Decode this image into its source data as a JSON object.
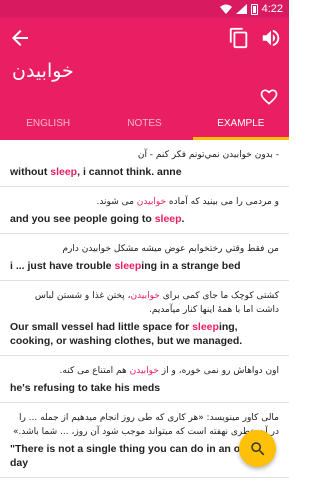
{
  "status_bar": {
    "time": "4:22",
    "battery_label": "2"
  },
  "header": {
    "word": "خوابیدن"
  },
  "tabs": [
    {
      "label": "ENGLISH",
      "active": false
    },
    {
      "label": "NOTES",
      "active": false
    },
    {
      "label": "EXAMPLE",
      "active": true
    }
  ],
  "examples": [
    {
      "fa_parts": [
        {
          "text": "- بدون خوابیدن نمي‌تونم فكر كنم - آن",
          "hl": false
        }
      ],
      "en_parts": [
        {
          "text": "without ",
          "hl": false
        },
        {
          "text": "sleep",
          "hl": true
        },
        {
          "text": ", i cannot think. anne",
          "hl": false
        }
      ]
    },
    {
      "fa_parts": [
        {
          "text": "و مردمی را می بینید که آماده ",
          "hl": false
        },
        {
          "text": "خوابیدن",
          "hl": true
        },
        {
          "text": " می شوند.",
          "hl": false
        }
      ],
      "en_parts": [
        {
          "text": "and you see people going to ",
          "hl": false
        },
        {
          "text": "sleep",
          "hl": true
        },
        {
          "text": ".",
          "hl": false
        }
      ]
    },
    {
      "fa_parts": [
        {
          "text": "من فقط وقتي رختخوابم عوض ميشه مشكل خوابيدن دارم",
          "hl": false
        }
      ],
      "en_parts": [
        {
          "text": "i ... just have trouble ",
          "hl": false
        },
        {
          "text": "sleep",
          "hl": true
        },
        {
          "text": "ing in a strange bed",
          "hl": false
        }
      ]
    },
    {
      "fa_parts": [
        {
          "text": "کشتی کوچک ما جای کمی برای ",
          "hl": false
        },
        {
          "text": "خوابیدن",
          "hl": true
        },
        {
          "text": "، پختن غذا و شستن لباس داشت اما با همهٔ اینها کنار میآمدیم.",
          "hl": false
        }
      ],
      "en_parts": [
        {
          "text": "Our small vessel had little space for ",
          "hl": false
        },
        {
          "text": "sleep",
          "hl": true
        },
        {
          "text": "ing, cooking, or washing clothes, but we managed.",
          "hl": false
        }
      ]
    },
    {
      "fa_parts": [
        {
          "text": "اون دواهاش رو نمی خوره، و از ",
          "hl": false
        },
        {
          "text": "خوابیدن",
          "hl": true
        },
        {
          "text": " هم امتناع می کنه.",
          "hl": false
        }
      ],
      "en_parts": [
        {
          "text": "he's refusing to take his meds",
          "hl": false
        }
      ]
    },
    {
      "fa_parts": [
        {
          "text": "مالی کاور مینویسد: «هر کاری که طی روز انجام میدهیم از جمله ... را در آن خطری نهفته است که میتواند موجب شود آن روز، ... شما باشد.»",
          "hl": false
        }
      ],
      "en_parts": [
        {
          "text": "\"There is not a single thing you can do in an ordinary day",
          "hl": false
        }
      ]
    }
  ]
}
